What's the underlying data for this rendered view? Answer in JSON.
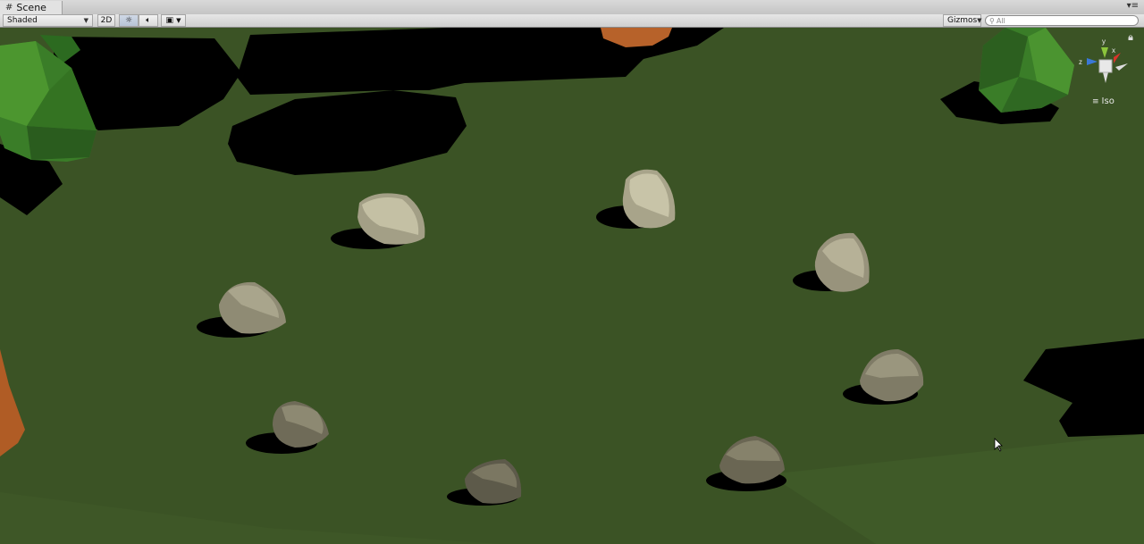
{
  "window": {
    "tab_title": "Scene"
  },
  "toolbar": {
    "shading_mode": "Shaded",
    "mode_2d": "2D",
    "gizmos_label": "Gizmos",
    "search_placeholder": "All"
  },
  "viewport": {
    "projection_label": "Iso",
    "gizmo_axes": {
      "y": "y",
      "x": "x",
      "z": "z"
    }
  },
  "colors": {
    "ground": "#3b5325",
    "shadow": "#000000",
    "tree_foliage": "#3a7d28",
    "tree_trunk": "#c06a2a",
    "rock": "#a7a48c",
    "gizmo_x": "#d9342b",
    "gizmo_y": "#8cc53c",
    "gizmo_z": "#3a78d8"
  },
  "icons": [
    "scene-grid-icon",
    "tab-menu-icon",
    "lighting-icon",
    "audio-icon",
    "effects-icon",
    "search-icon",
    "lock-icon",
    "iso-icon",
    "cursor-icon"
  ]
}
